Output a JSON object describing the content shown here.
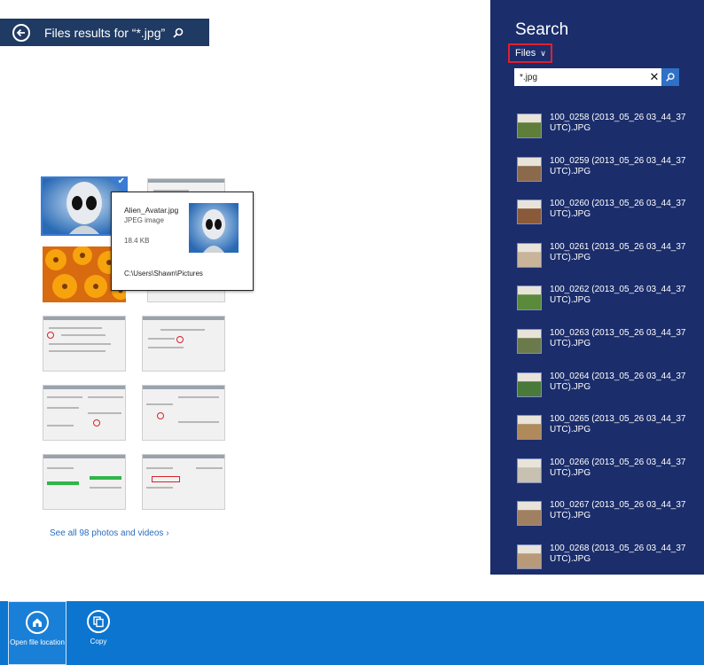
{
  "header": {
    "title": "Files results for “*.jpg”"
  },
  "tooltip": {
    "filename": "Alien_Avatar.jpg",
    "filetype": "JPEG image",
    "size": "18.4 KB",
    "path": "C:\\Users\\Shawn\\Pictures"
  },
  "see_all": "See all 98 photos and videos ›",
  "search_pane": {
    "title": "Search",
    "scope": "Files",
    "query": "*.jpg",
    "results": [
      {
        "name": "100_0258 (2013_05_26 03_44_37 UTC).JPG",
        "thumb_color": "#5e7e3a"
      },
      {
        "name": "100_0259 (2013_05_26 03_44_37 UTC).JPG",
        "thumb_color": "#8a6a4a"
      },
      {
        "name": "100_0260 (2013_05_26 03_44_37 UTC).JPG",
        "thumb_color": "#8a5a3a"
      },
      {
        "name": "100_0261 (2013_05_26 03_44_37 UTC).JPG",
        "thumb_color": "#c9b49a"
      },
      {
        "name": "100_0262 (2013_05_26 03_44_37 UTC).JPG",
        "thumb_color": "#5a8a3a"
      },
      {
        "name": "100_0263 (2013_05_26 03_44_37 UTC).JPG",
        "thumb_color": "#6a7a4a"
      },
      {
        "name": "100_0264 (2013_05_26 03_44_37 UTC).JPG",
        "thumb_color": "#4a7a3a"
      },
      {
        "name": "100_0265 (2013_05_26 03_44_37 UTC).JPG",
        "thumb_color": "#b08a5a"
      },
      {
        "name": "100_0266 (2013_05_26 03_44_37 UTC).JPG",
        "thumb_color": "#c8c0b0"
      },
      {
        "name": "100_0267 (2013_05_26 03_44_37 UTC).JPG",
        "thumb_color": "#a08060"
      },
      {
        "name": "100_0268 (2013_05_26 03_44_37 UTC).JPG",
        "thumb_color": "#b89a7a"
      }
    ]
  },
  "app_bar": {
    "open_location": "Open file location",
    "copy": "Copy"
  },
  "colors": {
    "pane_bg": "#1b2d6b",
    "header_bg": "#1f3a63",
    "appbar_bg": "#0b75d0",
    "scope_outline": "#e0202d",
    "link": "#2a6ebd"
  },
  "icons": [
    "back-arrow-icon",
    "search-icon",
    "chevron-down-icon",
    "clear-icon",
    "home-folder-icon",
    "copy-icon",
    "checkmark-icon"
  ]
}
